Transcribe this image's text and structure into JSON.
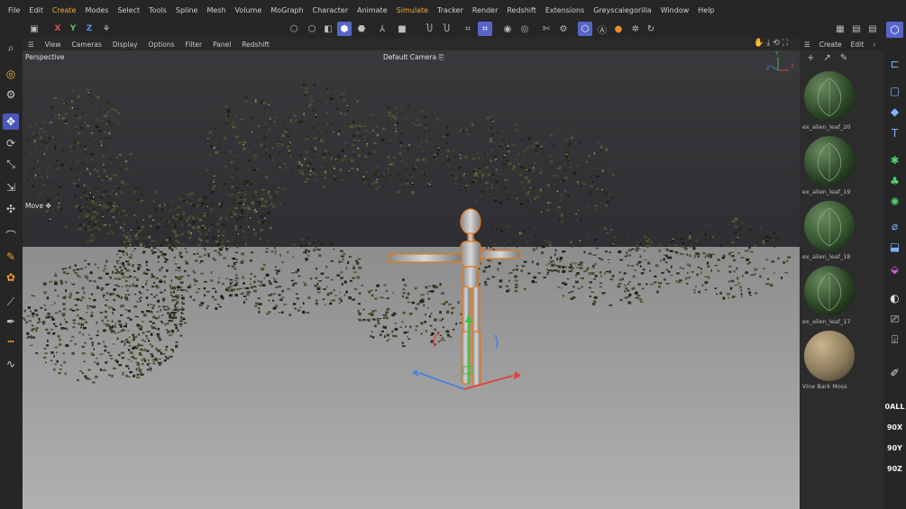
{
  "menu": [
    "File",
    "Edit",
    "Create",
    "Modes",
    "Select",
    "Tools",
    "Spline",
    "Mesh",
    "Volume",
    "MoGraph",
    "Character",
    "Animate",
    "Simulate",
    "Tracker",
    "Render",
    "Redshift",
    "Extensions",
    "Greyscalegorilla",
    "Window",
    "Help"
  ],
  "highlighted_menu": [
    "Create",
    "Simulate"
  ],
  "toolbar": {
    "axes": {
      "x": "X",
      "y": "Y",
      "z": "Z"
    }
  },
  "viewport": {
    "menu": [
      "View",
      "Cameras",
      "Display",
      "Options",
      "Filter",
      "Panel",
      "Redshift"
    ],
    "projection_label": "Perspective",
    "camera_label": "Default Camera",
    "tool_label": "Move",
    "axis_gizmo_letters": {
      "x": "X",
      "y": "Y",
      "z": "Z"
    }
  },
  "right_panel": {
    "tabs": [
      "Create",
      "Edit"
    ],
    "materials": [
      {
        "name": "ex_alien_leaf_20",
        "color": "#2f4a2a"
      },
      {
        "name": "ex_alien_leaf_19",
        "color": "#2c4628"
      },
      {
        "name": "ex_alien_leaf_18",
        "color": "#355530"
      },
      {
        "name": "ex_alien_leaf_17",
        "color": "#2a4424"
      },
      {
        "name": "Vine Bark Moss",
        "color": "#8a7a5a"
      }
    ]
  },
  "right_tools_labels": [
    "0ALL",
    "90X",
    "90Y",
    "90Z"
  ],
  "colors": {
    "accent": "#5865c8",
    "menu_highlight": "#f0a830",
    "floor": "#a7a7a7",
    "sky": "#2e2e31",
    "selection_outline": "#e07a20"
  }
}
